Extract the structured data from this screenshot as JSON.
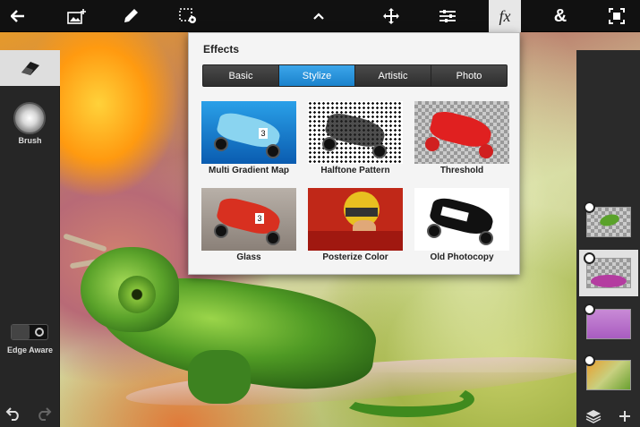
{
  "toolbar": {
    "icons": [
      "back-arrow-icon",
      "add-image-icon",
      "pencil-icon",
      "selection-settings-icon",
      "chevron-up-icon",
      "move-icon",
      "adjustments-icon",
      "fx-icon",
      "ampersand-icon",
      "fit-screen-icon"
    ],
    "fx_label": "fx"
  },
  "left_panel": {
    "brush_label": "Brush",
    "edge_aware_label": "Edge Aware"
  },
  "effects": {
    "title": "Effects",
    "tabs": [
      {
        "label": "Basic",
        "active": false
      },
      {
        "label": "Stylize",
        "active": true
      },
      {
        "label": "Artistic",
        "active": false
      },
      {
        "label": "Photo",
        "active": false
      }
    ],
    "items": [
      {
        "label": "Multi Gradient Map"
      },
      {
        "label": "Halftone Pattern"
      },
      {
        "label": "Threshold"
      },
      {
        "label": "Glass"
      },
      {
        "label": "Posterize Color"
      },
      {
        "label": "Old Photocopy"
      }
    ]
  },
  "colors": {
    "accent": "#1a82cc",
    "toolbar_bg": "#111111",
    "popover_bg": "#f4f4f4"
  }
}
